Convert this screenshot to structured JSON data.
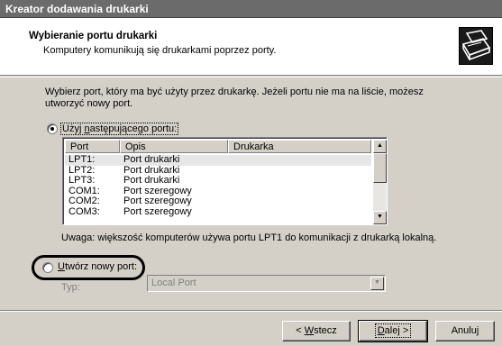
{
  "window": {
    "title": "Kreator dodawania drukarki"
  },
  "header": {
    "title": "Wybieranie portu drukarki",
    "subtitle": "Komputery komunikują się drukarkami poprzez porty."
  },
  "intro_text": "Wybierz port, który ma być użyty przez drukarkę. Jeżeli portu nie ma na liście, możesz utworzyć nowy port.",
  "use_existing_port": {
    "prefix": "Użyj ",
    "accel": "n",
    "suffix": "astępującego portu:",
    "checked": true
  },
  "port_list": {
    "columns": [
      "Port",
      "Opis",
      "Drukarka"
    ],
    "rows": [
      {
        "port": "LPT1:",
        "description": "Port drukarki",
        "printer": ""
      },
      {
        "port": "LPT2:",
        "description": "Port drukarki",
        "printer": ""
      },
      {
        "port": "LPT3:",
        "description": "Port drukarki",
        "printer": ""
      },
      {
        "port": "COM1:",
        "description": "Port szeregowy",
        "printer": ""
      },
      {
        "port": "COM2:",
        "description": "Port szeregowy",
        "printer": ""
      },
      {
        "port": "COM3:",
        "description": "Port szeregowy",
        "printer": ""
      }
    ],
    "selected_index": 0
  },
  "note_text": "Uwaga: większość komputerów używa portu LPT1 do komunikacji z drukarką lokalną.",
  "create_new_port": {
    "accel": "U",
    "suffix": "twórz nowy port:",
    "checked": false,
    "type_label": "Typ:",
    "type_value": "Local Port"
  },
  "buttons": {
    "back": {
      "prefix": "< ",
      "accel": "W",
      "suffix": "stecz"
    },
    "next": {
      "accel": "D",
      "suffix": "alej >"
    },
    "cancel": "Anuluj"
  }
}
